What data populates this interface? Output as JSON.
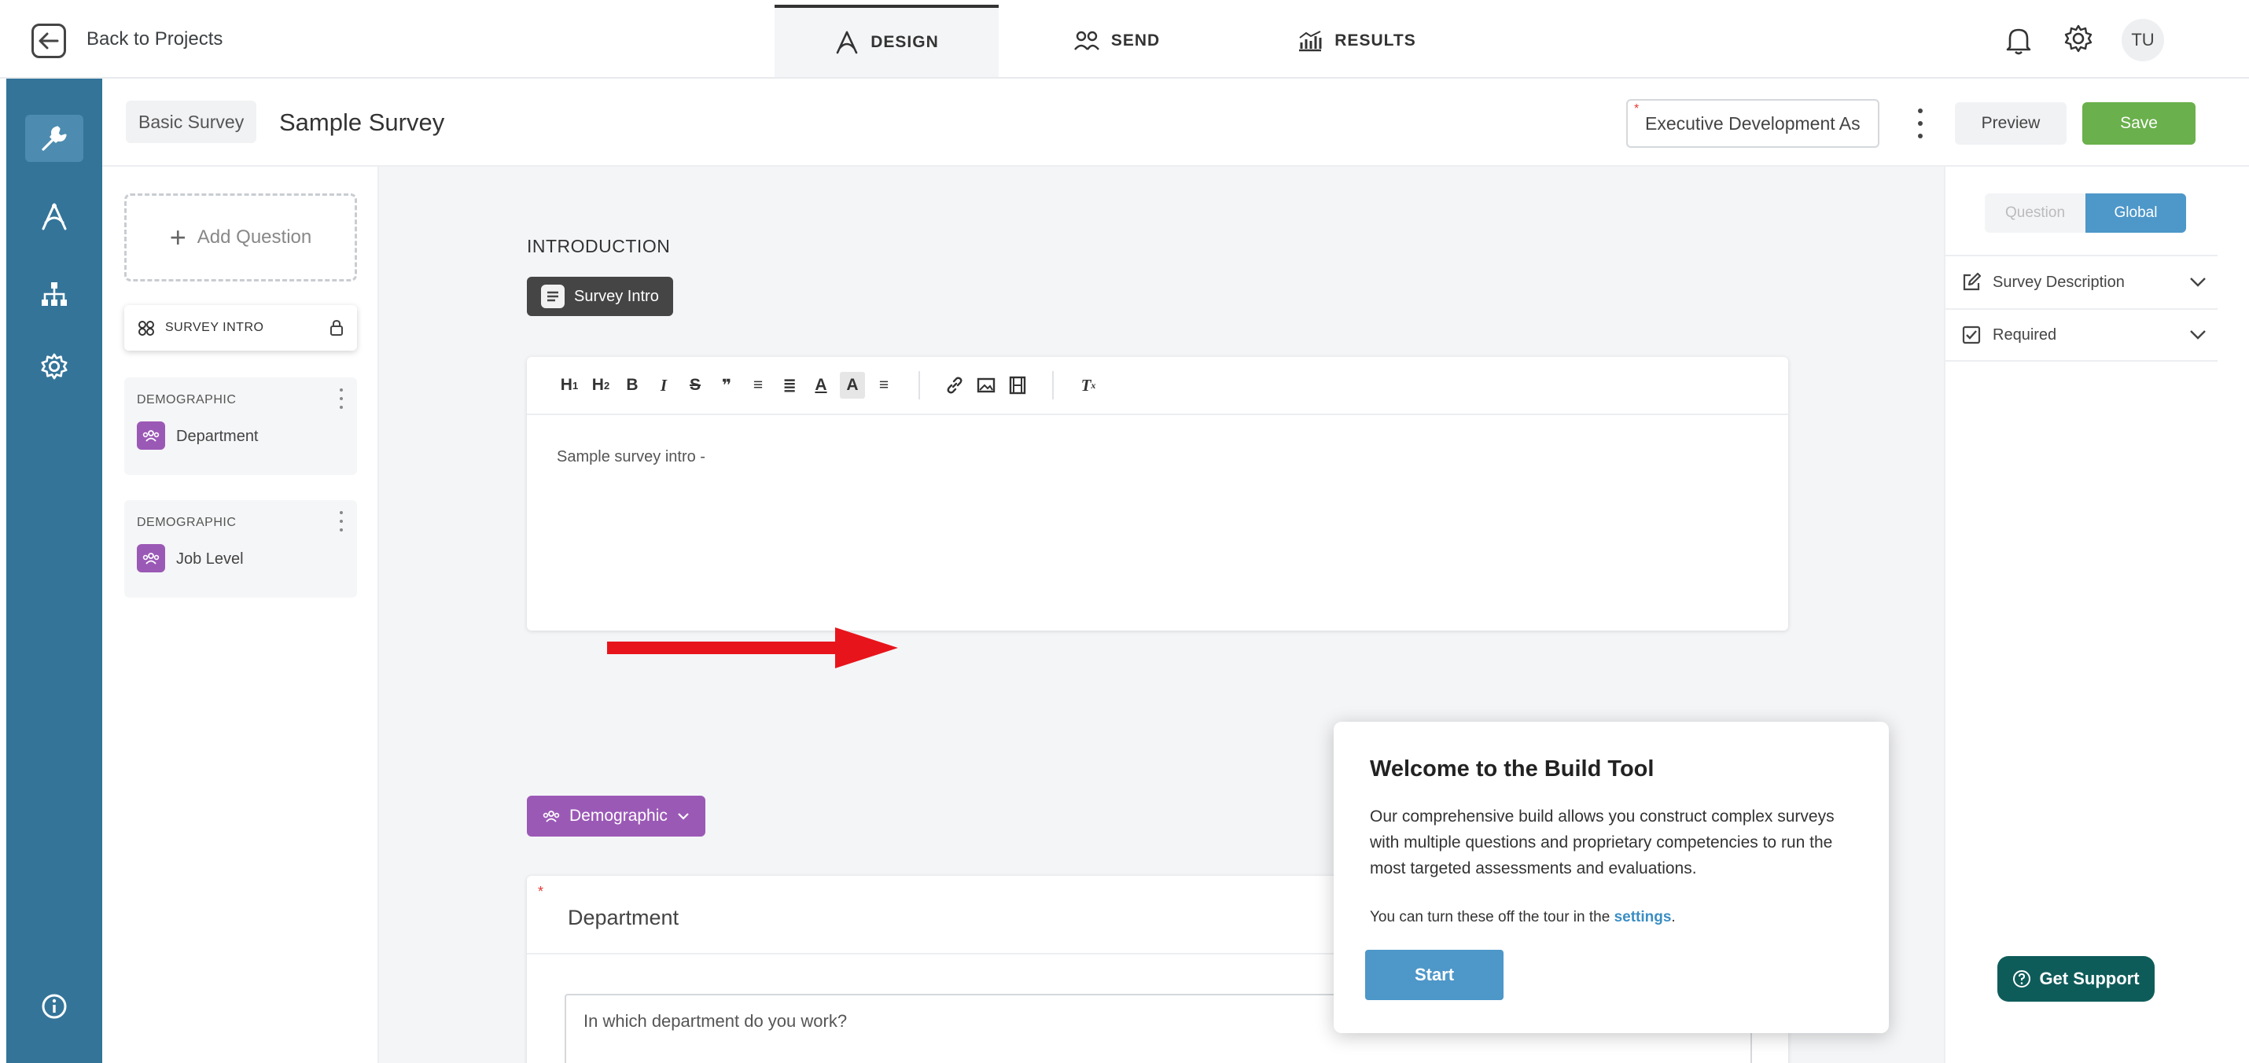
{
  "topbar": {
    "back_label": "Back to Projects",
    "tabs": [
      {
        "label": "DESIGN",
        "icon": "design-icon",
        "active": true
      },
      {
        "label": "SEND",
        "icon": "people-icon",
        "active": false
      },
      {
        "label": "RESULTS",
        "icon": "chart-icon",
        "active": false
      }
    ],
    "avatar_initials": "TU"
  },
  "rail": {
    "items": [
      "wrench-icon",
      "design-icon",
      "hierarchy-icon",
      "gear-icon",
      "info-icon"
    ],
    "color": "#347499"
  },
  "subheader": {
    "survey_type": "Basic Survey",
    "survey_title": "Sample Survey",
    "assessment_value": "Executive Development As",
    "assessment_required_mark": "*",
    "preview_label": "Preview",
    "save_label": "Save"
  },
  "question_panel": {
    "add_question_label": "Add Question",
    "survey_intro_label": "SURVEY INTRO",
    "items": [
      {
        "category": "DEMOGRAPHIC",
        "name": "Department"
      },
      {
        "category": "DEMOGRAPHIC",
        "name": "Job Level"
      }
    ]
  },
  "canvas": {
    "intro_heading": "INTRODUCTION",
    "intro_tag": "Survey Intro",
    "toolbar_buttons": {
      "h1": "H",
      "h1_sub": "1",
      "h2": "H",
      "h2_sub": "2",
      "bold": "B",
      "italic": "I",
      "strike": "S",
      "quote": "❞",
      "ordered_list": "≡",
      "bullet_list": "≣",
      "font_color": "A",
      "highlight": "A",
      "align": "≡",
      "link": "🔗",
      "image": "▣",
      "video": "▤",
      "clear": "T"
    },
    "intro_text": "Sample survey intro -",
    "demographic_tag": "Demographic",
    "question": {
      "required_mark": "*",
      "title": "Department",
      "text": "In which department do you work?"
    }
  },
  "properties": {
    "tab_question": "Question",
    "tab_global": "Global",
    "rows": [
      {
        "label": "Survey Description",
        "icon": "edit-icon"
      },
      {
        "label": "Required",
        "icon": "checkbox-icon"
      }
    ]
  },
  "welcome_popup": {
    "title": "Welcome to the Build Tool",
    "body": "Our comprehensive build allows you construct complex surveys with multiple questions and proprietary competencies to run the most targeted assessments and evaluations.",
    "note_prefix": "You can turn these off the tour in the",
    "note_link": "settings",
    "note_suffix": ".",
    "start_label": "Start"
  },
  "support": {
    "label": "Get Support"
  },
  "colors": {
    "accent_blue": "#4d97c9",
    "save_green": "#6ab04c",
    "demographic_purple": "#9b59b6",
    "support_teal": "#0e5c5a",
    "annotation_red": "#e8141b"
  }
}
